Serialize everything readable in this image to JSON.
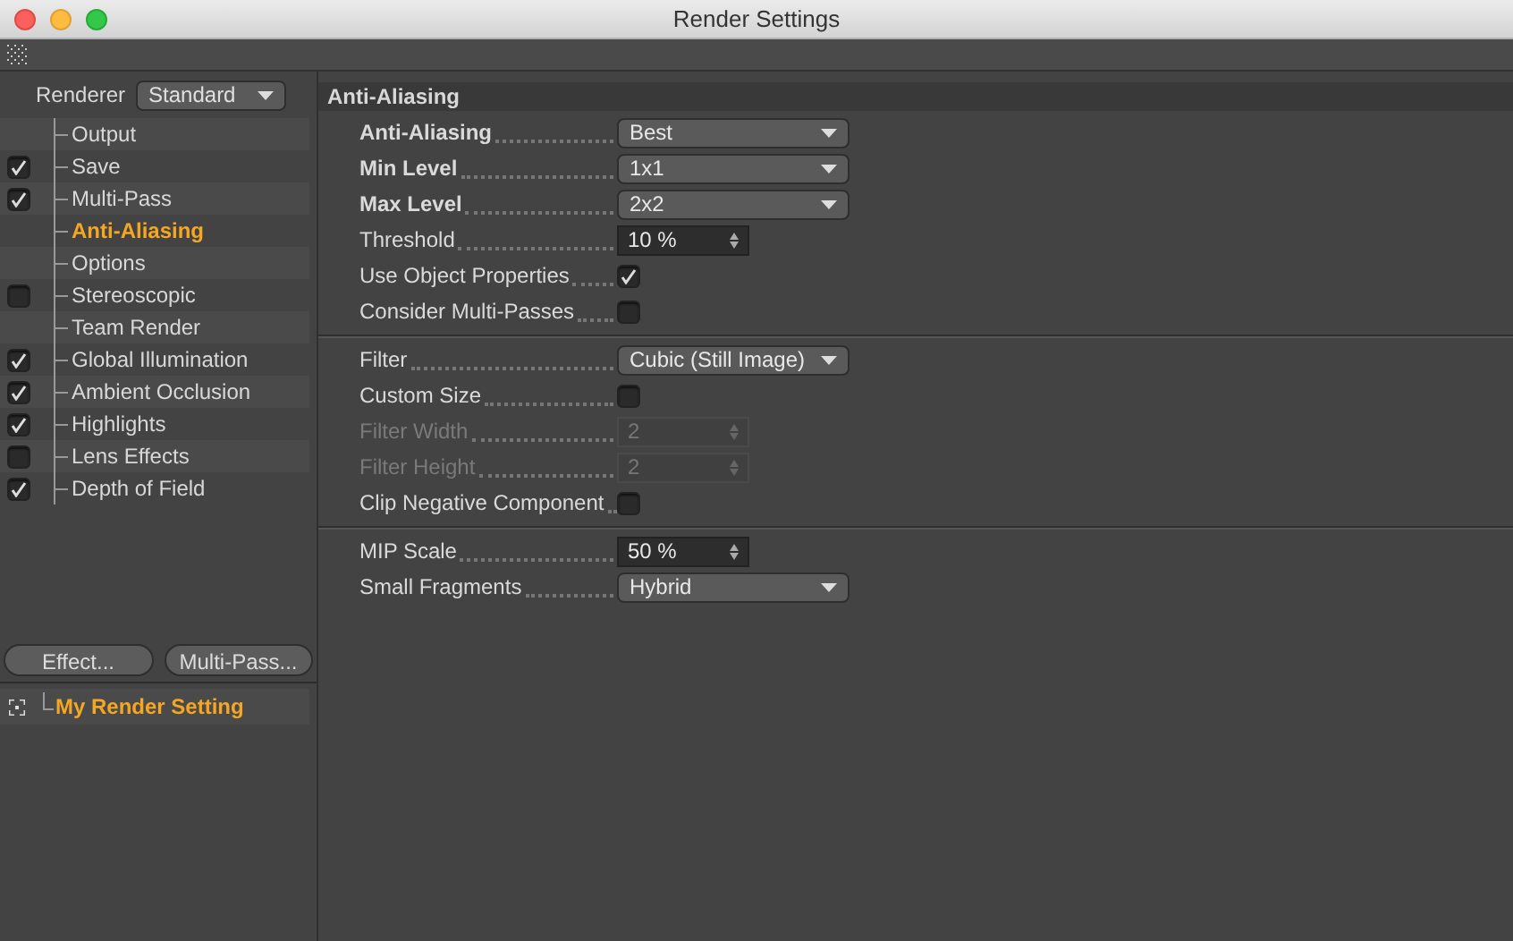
{
  "window": {
    "title": "Render Settings"
  },
  "renderer": {
    "label": "Renderer",
    "value": "Standard"
  },
  "sidebar": {
    "items": [
      {
        "label": "Output",
        "kind": "plain",
        "selected": false
      },
      {
        "label": "Save",
        "kind": "checkbox",
        "checked": true,
        "selected": false
      },
      {
        "label": "Multi-Pass",
        "kind": "checkbox",
        "checked": true,
        "selected": false
      },
      {
        "label": "Anti-Aliasing",
        "kind": "plain",
        "selected": true
      },
      {
        "label": "Options",
        "kind": "plain",
        "selected": false
      },
      {
        "label": "Stereoscopic",
        "kind": "checkbox",
        "checked": false,
        "selected": false
      },
      {
        "label": "Team Render",
        "kind": "plain",
        "selected": false
      },
      {
        "label": "Global Illumination",
        "kind": "checkbox",
        "checked": true,
        "selected": false
      },
      {
        "label": "Ambient Occlusion",
        "kind": "checkbox",
        "checked": true,
        "selected": false
      },
      {
        "label": "Highlights",
        "kind": "checkbox",
        "checked": true,
        "selected": false
      },
      {
        "label": "Lens Effects",
        "kind": "checkbox",
        "checked": false,
        "selected": false
      },
      {
        "label": "Depth of Field",
        "kind": "checkbox",
        "checked": true,
        "selected": false
      }
    ]
  },
  "buttons": [
    "Effect...",
    "Multi-Pass..."
  ],
  "settings_list": [
    {
      "label": "My Render Setting",
      "selected": true
    }
  ],
  "panel": {
    "title": "Anti-Aliasing",
    "sections": [
      [
        {
          "label": "Anti-Aliasing",
          "kind": "dropdown",
          "value": "Best",
          "bold": true,
          "disabled": false
        },
        {
          "label": "Min Level",
          "kind": "dropdown",
          "value": "1x1",
          "bold": true,
          "disabled": false
        },
        {
          "label": "Max Level",
          "kind": "dropdown",
          "value": "2x2",
          "bold": true,
          "disabled": false
        },
        {
          "label": "Threshold",
          "kind": "spinner",
          "value": "10 %",
          "bold": false,
          "disabled": false
        },
        {
          "label": "Use Object Properties",
          "kind": "checkbox",
          "checked": true,
          "bold": false,
          "disabled": false
        },
        {
          "label": "Consider Multi-Passes",
          "kind": "checkbox",
          "checked": false,
          "bold": false,
          "disabled": false
        }
      ],
      [
        {
          "label": "Filter",
          "kind": "dropdown",
          "value": "Cubic (Still Image)",
          "bold": false,
          "disabled": false
        },
        {
          "label": "Custom Size",
          "kind": "checkbox",
          "checked": false,
          "bold": false,
          "disabled": false
        },
        {
          "label": "Filter Width",
          "kind": "spinner",
          "value": "2",
          "bold": false,
          "disabled": true
        },
        {
          "label": "Filter Height",
          "kind": "spinner",
          "value": "2",
          "bold": false,
          "disabled": true
        },
        {
          "label": "Clip Negative Component",
          "kind": "checkbox",
          "checked": false,
          "bold": false,
          "disabled": false
        }
      ],
      [
        {
          "label": "MIP Scale",
          "kind": "spinner",
          "value": "50 %",
          "bold": false,
          "disabled": false
        },
        {
          "label": "Small Fragments",
          "kind": "dropdown",
          "value": "Hybrid",
          "bold": false,
          "disabled": false
        }
      ]
    ]
  }
}
